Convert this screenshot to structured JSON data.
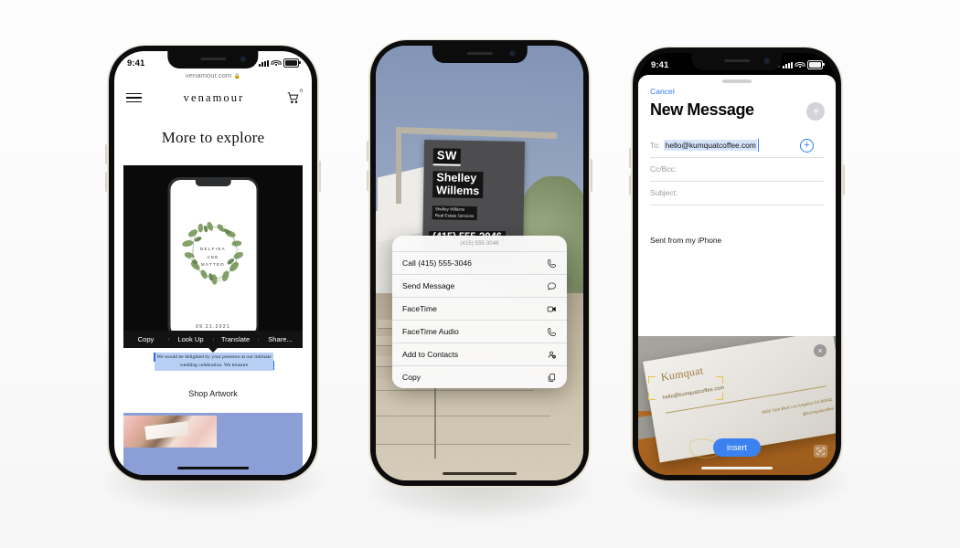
{
  "scene": {
    "background_color": "#fbfbfb",
    "device_frame_color": "#e8e2d6"
  },
  "phone1": {
    "name": "venamour-website",
    "status": {
      "time": "9:41",
      "signal_icon": "cellular-bars-icon",
      "wifi_icon": "wifi-icon",
      "battery_icon": "battery-icon"
    },
    "url": "venamour.com",
    "lock_glyph": "🔒",
    "nav": {
      "menu_icon": "hamburger-menu-icon",
      "brand": "venamour",
      "cart_icon": "shopping-cart-icon",
      "cart_count": "0"
    },
    "heading": "More to explore",
    "artwork": {
      "names": [
        "DELFINA",
        "AND",
        "MATTEO"
      ],
      "date": "09.21.2021"
    },
    "text_menu": [
      "Copy",
      "Look Up",
      "Translate",
      "Share..."
    ],
    "selected_text": "We would be delighted by your presence at our intimate wedding celebration. We treasure",
    "shop_label": "Shop Artwork",
    "selection_color": "#b9d0f5"
  },
  "phone2": {
    "name": "camera-live-text",
    "sign": {
      "initials": "SW",
      "line1": "Shelley",
      "line2": "Willems",
      "sub1": "Shelley Willems",
      "sub2": "Real Estate Services",
      "phone": "(415) 555-3046"
    },
    "popover": {
      "header": "(415) 555-3046",
      "items": [
        {
          "label": "Call (415) 555-3046",
          "icon": "phone-icon"
        },
        {
          "label": "Send Message",
          "icon": "message-bubble-icon"
        },
        {
          "label": "FaceTime",
          "icon": "video-camera-icon"
        },
        {
          "label": "FaceTime Audio",
          "icon": "phone-icon"
        },
        {
          "label": "Add to Contacts",
          "icon": "add-contact-icon"
        },
        {
          "label": "Copy",
          "icon": "copy-icon"
        }
      ]
    }
  },
  "phone3": {
    "name": "mail-compose-live-text",
    "status": {
      "time": "9:41",
      "camera_indicator": "green-privacy-dot",
      "signal_icon": "cellular-bars-icon",
      "wifi_icon": "wifi-icon",
      "battery_icon": "battery-icon"
    },
    "compose": {
      "cancel": "Cancel",
      "title": "New Message",
      "send_icon": "send-arrow-up-icon",
      "to_label": "To:",
      "to_value": "hello@kumquatcoffee.com",
      "add_contact_icon": "plus-circle-icon",
      "cc_label": "Cc/Bcc:",
      "subject_label": "Subject:",
      "body": "Sent from my iPhone"
    },
    "card": {
      "brand": "Kumquat",
      "email": "hello@kumquatcoffee.com",
      "address": "4836 York Blvd Los Angeles CA 90042",
      "handle": "@kumquatcoffee"
    },
    "insert_label": "insert",
    "close_icon": "close-x-icon",
    "scan_icon": "live-text-scan-icon",
    "accent_color": "#3b82f0"
  }
}
